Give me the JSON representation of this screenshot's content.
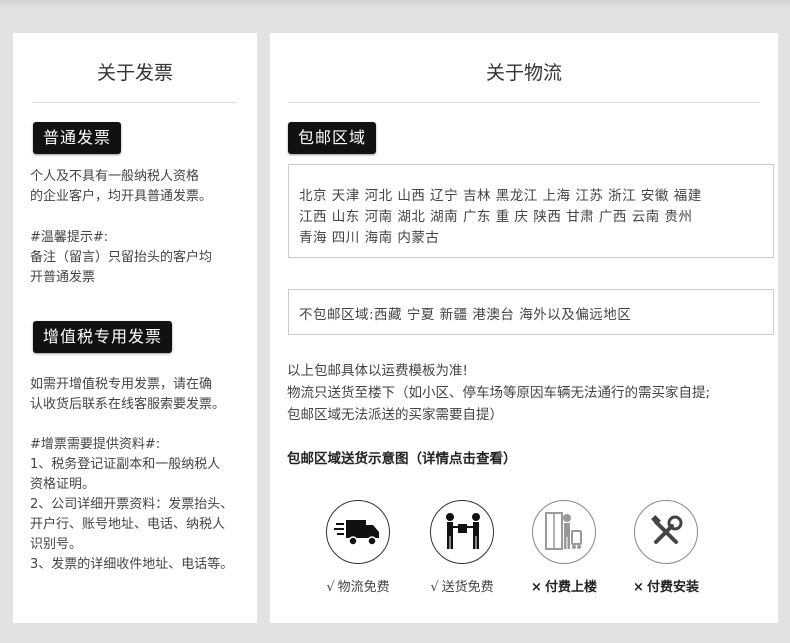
{
  "left_panel": {
    "title": "关于发票",
    "section1": {
      "badge": "普通发票",
      "lines": [
        "个人及不具有一般纳税人资格",
        "的企业客户，均开具普通发票。"
      ]
    },
    "tip": {
      "heading": "#温馨提示#:",
      "lines": [
        "备注（留言）只留抬头的客户均",
        "开普通发票"
      ]
    },
    "section2": {
      "badge": "增值税专用发票",
      "lines": [
        "如需开增值税专用发票，请在确",
        "认收货后联系在线客服索要发票。"
      ]
    },
    "materials": {
      "heading": "#增票需要提供资料#:",
      "lines": [
        "1、税务登记证副本和一般纳税人",
        "资格证明。",
        "2、公司详细开票资料：发票抬头、",
        "开户行、账号地址、电话、纳税人",
        "识别号。",
        "3、发票的详细收件地址、电话等。"
      ]
    }
  },
  "right_panel": {
    "title": "关于物流",
    "badge": "包邮区域",
    "province_lines": [
      "北京  天津  河北  山西  辽宁  吉林  黑龙江  上海  江苏  浙江  安徽  福建",
      "江西  山东  河南  湖北  湖南  广东  重  庆  陕西  甘肃  广西  云南  贵州",
      "青海  四川  海南  内蒙古"
    ],
    "excluded": "不包邮区域:西藏 宁夏 新疆 港澳台 海外以及偏远地区",
    "notes": [
      "以上包邮具体以运费模板为准!",
      "物流只送货至楼下（如小区、停车场等原因车辆无法通行的需买家自提;",
      "包邮区域无法派送的买家需要自提）"
    ],
    "diagram_heading": "包邮区域送货示意图（详情点击查看）",
    "services": [
      {
        "icon": "truck-icon",
        "mark": "√",
        "label": "物流免费"
      },
      {
        "icon": "delivery-handover-icon",
        "mark": "√",
        "label": "送货免费"
      },
      {
        "icon": "elevator-porter-icon",
        "mark": "×",
        "label": "付费上楼"
      },
      {
        "icon": "wrench-screwdriver-icon",
        "mark": "×",
        "label": "付费安装"
      }
    ]
  }
}
